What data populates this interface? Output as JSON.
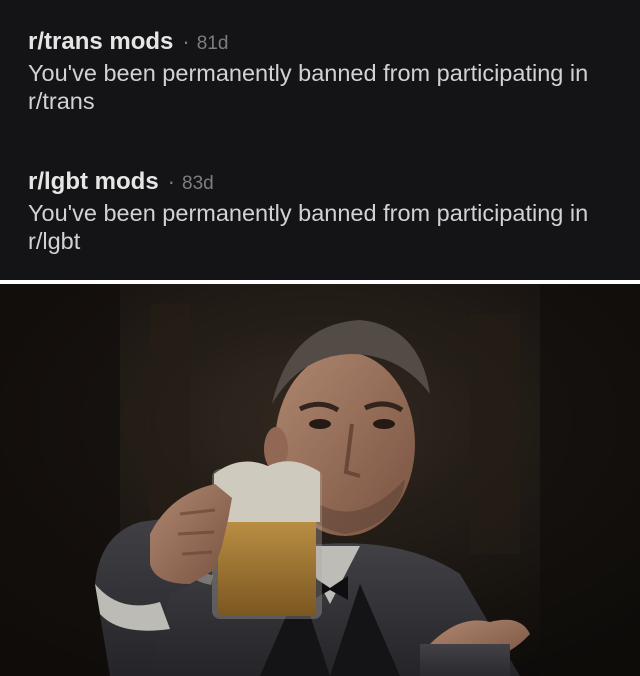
{
  "messages": [
    {
      "sender": "r/trans mods",
      "separator": "·",
      "age": "81d",
      "body": "You've been permanently banned from participating in r/trans"
    },
    {
      "sender": "r/lgbt mods",
      "separator": "·",
      "age": "83d",
      "body": "You've been permanently banned from participating in r/lgbt"
    }
  ],
  "scene": {
    "background_color": "#1a1613",
    "beer_color": "#b88a3a",
    "foam_color": "#e9e4d6"
  }
}
